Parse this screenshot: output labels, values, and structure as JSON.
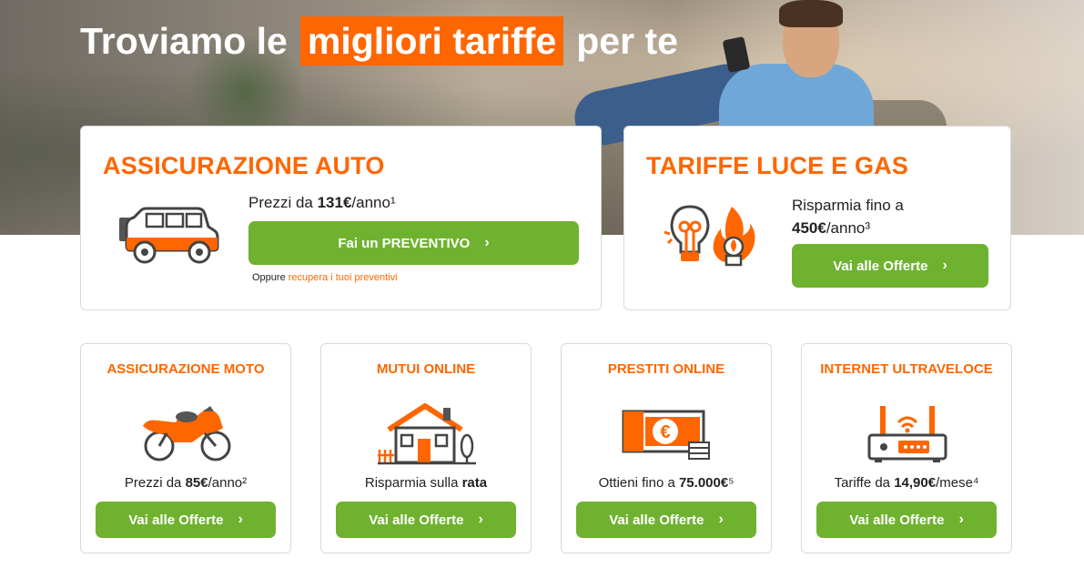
{
  "hero": {
    "headline_before": "Troviamo le",
    "headline_highlight": "migliori tariffe",
    "headline_after": "per te"
  },
  "auto": {
    "title": "ASSICURAZIONE AUTO",
    "price_prefix": "Prezzi da ",
    "price_value": "131€",
    "price_suffix": "/anno¹",
    "button": "Fai un PREVENTIVO",
    "alt_prefix": "Oppure ",
    "alt_link": "recupera i tuoi preventivi",
    "icon": "car-icon"
  },
  "energy": {
    "title": "TARIFFE LUCE E GAS",
    "line1": "Risparmia fino a",
    "value": "450€",
    "suffix": "/anno³",
    "button": "Vai alle Offerte",
    "icon": "bulb-flame-icon"
  },
  "small_cards": [
    {
      "title": "ASSICURAZIONE MOTO",
      "text_prefix": "Prezzi da ",
      "value": "85€",
      "text_suffix": "/anno²",
      "button": "Vai alle Offerte",
      "icon": "motorcycle-icon"
    },
    {
      "title": "MUTUI ONLINE",
      "text_prefix": "Risparmia sulla ",
      "value": "rata",
      "text_suffix": "",
      "button": "Vai alle Offerte",
      "icon": "house-icon"
    },
    {
      "title": "PRESTITI ONLINE",
      "text_prefix": "Ottieni fino a ",
      "value": "75.000€",
      "text_suffix": "⁵",
      "button": "Vai alle Offerte",
      "icon": "euro-banknote-icon"
    },
    {
      "title": "INTERNET ULTRAVELOCE",
      "text_prefix": "Tariffe da ",
      "value": "14,90€",
      "text_suffix": "/mese⁴",
      "button": "Vai alle Offerte",
      "icon": "router-icon"
    }
  ],
  "colors": {
    "orange": "#ff6600",
    "green": "#6fb230",
    "card_border": "#d9d9d9"
  }
}
